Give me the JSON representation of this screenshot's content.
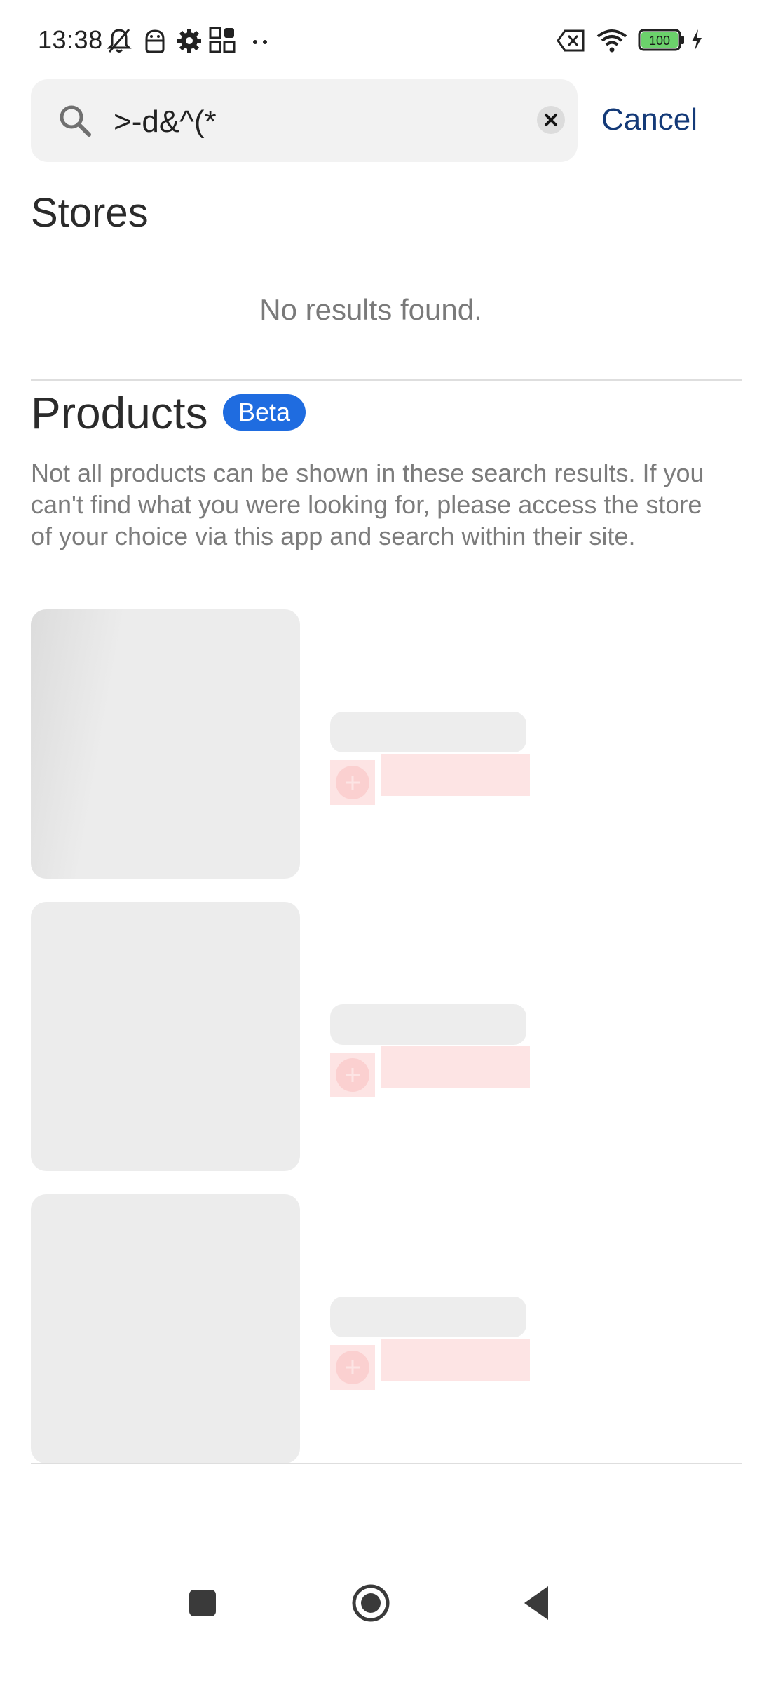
{
  "status_bar": {
    "time": "13:38",
    "left_icons": [
      "bell-off-icon",
      "android-icon",
      "gear-icon",
      "apps-grid-icon",
      "more-dots-icon"
    ],
    "right_icons": [
      "no-sim-icon",
      "wifi-icon",
      "battery-icon",
      "charging-icon"
    ],
    "battery_level": "100",
    "battery_color": "#6bd16b"
  },
  "search": {
    "query": ">-d&^(*",
    "cancel_label": "Cancel"
  },
  "stores": {
    "heading": "Stores",
    "empty_message": "No results found."
  },
  "products": {
    "heading": "Products",
    "badge": "Beta",
    "disclaimer": "Not all products can be shown in these search results. If you can't find what you were looking for, please access the store of your choice via this app and search within their site.",
    "loading_placeholders": 3
  },
  "colors": {
    "accent": "#1f6ce0",
    "cancel_text": "#143a78",
    "skeleton": "#ececec",
    "skeleton_pink": "#fde4e4"
  },
  "nav_bar": {
    "buttons": [
      "recents-square-icon",
      "home-circle-icon",
      "back-triangle-icon"
    ]
  }
}
